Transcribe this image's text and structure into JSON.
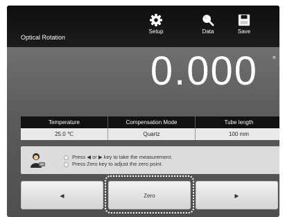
{
  "header": {
    "title": "Optical Rotation",
    "tools": [
      {
        "label": "Setup",
        "icon": "gear-icon"
      },
      {
        "label": "Data",
        "icon": "magnifier-icon"
      },
      {
        "label": "Save",
        "icon": "floppy-disk-icon"
      }
    ]
  },
  "reading": {
    "value": "0.000",
    "unit": "°"
  },
  "params": {
    "headers": [
      "Temperature",
      "Compensation Mode",
      "Tube length"
    ],
    "values": [
      "25.0 ℃",
      "Quartz",
      "100 mm"
    ]
  },
  "message": {
    "icon": "operator-icon",
    "lines": [
      "Press ◀ or ▶ key to take the measurement.",
      "Press Zero key to adjust the zero point."
    ]
  },
  "buttons": {
    "left": "◀",
    "zero": "Zero",
    "right": "▶"
  },
  "colors": {
    "topbar": "#111111",
    "panel": "#5f5f5f",
    "button": "#e4e4e4"
  }
}
